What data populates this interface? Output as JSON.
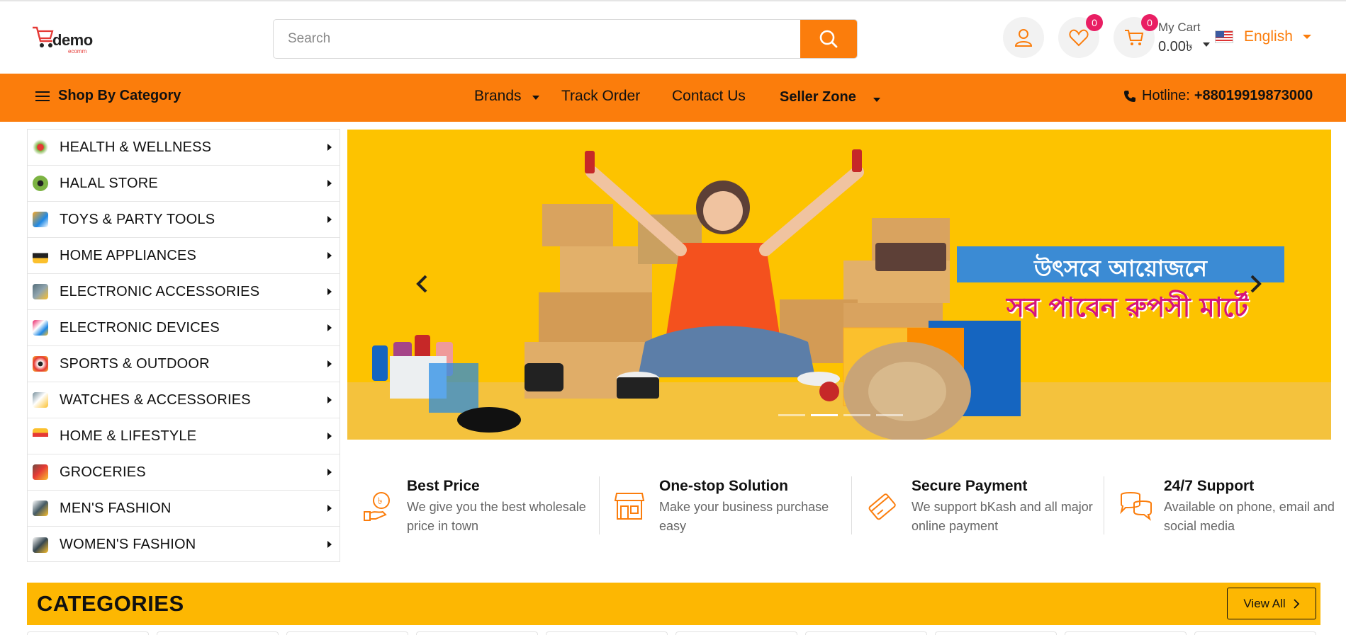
{
  "brand": {
    "logo_word": "demo",
    "logo_sub": "ecomm"
  },
  "search": {
    "placeholder": "Search",
    "value": ""
  },
  "header": {
    "wishlist_count": "0",
    "cart_count": "0",
    "cart_label": "My Cart",
    "cart_amount": "0.00৳",
    "language": "English"
  },
  "nav": {
    "shop_by_category": "Shop By Category",
    "items": [
      "Brands",
      "Track Order",
      "Contact Us",
      "Seller Zone"
    ],
    "hotline_label": "Hotline:",
    "hotline_number": "+88019919873000"
  },
  "sidebar": {
    "categories": [
      {
        "label": "HEALTH & WELLNESS",
        "icon": "health-icon"
      },
      {
        "label": "HALAL STORE",
        "icon": "halal-icon"
      },
      {
        "label": "TOYS & PARTY TOOLS",
        "icon": "toys-icon"
      },
      {
        "label": "HOME APPLIANCES",
        "icon": "appliance-icon"
      },
      {
        "label": "ELECTRONIC ACCESSORIES",
        "icon": "electronics-icon"
      },
      {
        "label": "ELECTRONIC DEVICES",
        "icon": "devices-icon"
      },
      {
        "label": "SPORTS & OUTDOOR",
        "icon": "sports-icon"
      },
      {
        "label": "WATCHES & ACCESSORIES",
        "icon": "watch-icon"
      },
      {
        "label": "HOME & LIFESTYLE",
        "icon": "home-icon"
      },
      {
        "label": "GROCERIES",
        "icon": "groceries-icon"
      },
      {
        "label": "MEN'S FASHION",
        "icon": "mens-fashion-icon"
      },
      {
        "label": "WOMEN'S FASHION",
        "icon": "womens-fashion-icon"
      }
    ]
  },
  "banner": {
    "line1": "উৎসবে আয়োজনে",
    "line2": "সব পাবেন রুপসী মার্টে",
    "slide_count": 4,
    "active_slide": 2
  },
  "features": [
    {
      "title": "Best Price",
      "desc": "We give you the best wholesale price in town",
      "icon": "price-tag-icon"
    },
    {
      "title": "One-stop Solution",
      "desc": "Make your business purchase easy",
      "icon": "store-icon"
    },
    {
      "title": "Secure Payment",
      "desc": "We support bKash and all major online payment",
      "icon": "card-icon"
    },
    {
      "title": "24/7 Support",
      "desc": "Available on phone, email and social media",
      "icon": "chat-icon"
    }
  ],
  "categories_section": {
    "title": "CATEGORIES",
    "view_all": "View All"
  },
  "colors": {
    "accent": "#fb7d0c",
    "category_bar": "#fdb702",
    "banner_bg": "#fdc300",
    "badge": "#e91e63"
  }
}
